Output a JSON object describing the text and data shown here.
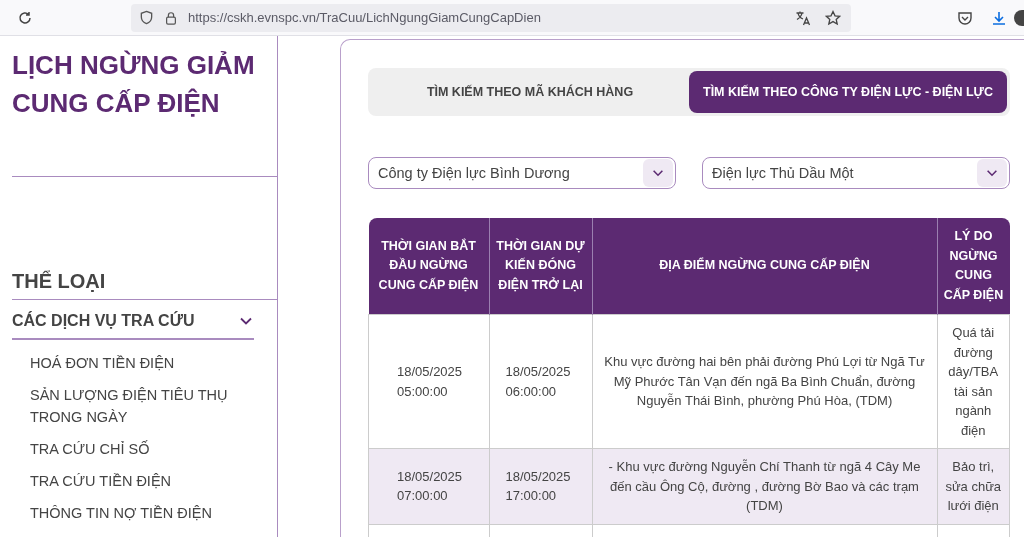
{
  "browser": {
    "url": "https://cskh.evnspc.vn/TraCuu/LichNgungGiamCungCapDien"
  },
  "sidebar": {
    "title": "LỊCH NGỪNG GIẢM CUNG CẤP ĐIỆN",
    "category_heading": "THỂ LOẠI",
    "group": {
      "label": "CÁC DỊCH VỤ TRA CỨU",
      "expanded": true,
      "items": [
        "HOÁ ĐƠN TIỀN ĐIỆN",
        "SẢN LƯỢNG ĐIỆN TIÊU THỤ TRONG NGÀY",
        "TRA CỨU CHỈ SỐ",
        "TRA CỨU TIỀN ĐIỆN",
        "THÔNG TIN NỢ TIỀN ĐIỆN"
      ]
    }
  },
  "tabs": [
    {
      "label": "TÌM KIẾM THEO MÃ KHÁCH HÀNG",
      "selected": false
    },
    {
      "label": "TÌM KIẾM THEO CÔNG TY ĐIỆN LỰC - ĐIỆN LỰC",
      "selected": true
    }
  ],
  "selects": [
    {
      "value": "Công ty Điện lực Bình Dương"
    },
    {
      "value": "Điện lực Thủ Dầu Một"
    }
  ],
  "table": {
    "columns": [
      "THỜI GIAN BẮT ĐẦU NGỪNG CUNG CẤP ĐIỆN",
      "THỜI GIAN DỰ KIẾN ĐÓNG ĐIỆN TRỞ LẠI",
      "ĐỊA ĐIỂM NGỪNG CUNG CẤP ĐIỆN",
      "LÝ DO NGỪNG CUNG CẤP ĐIỆN"
    ],
    "rows": [
      {
        "start": "18/05/2025 05:00:00",
        "end": "18/05/2025 06:00:00",
        "location": "Khu vực đường hai bên phải đường Phú Lợi từ Ngã Tư Mỹ Phước Tân Vạn đến ngã Ba Bình Chuẩn, đường Nguyễn Thái Bình, phường Phú Hòa, (TDM)",
        "reason": "Quá tải đường dây/TBA tài sản ngành điện"
      },
      {
        "start": "18/05/2025 07:00:00",
        "end": "18/05/2025 17:00:00",
        "location": "- Khu vực đường Nguyễn Chí Thanh từ ngã 4 Cây Me đến cầu Ông Cộ, đường , đường Bờ Bao và các trạm (TDM)",
        "reason": "Bảo trì, sửa chữa lưới điện"
      }
    ]
  }
}
